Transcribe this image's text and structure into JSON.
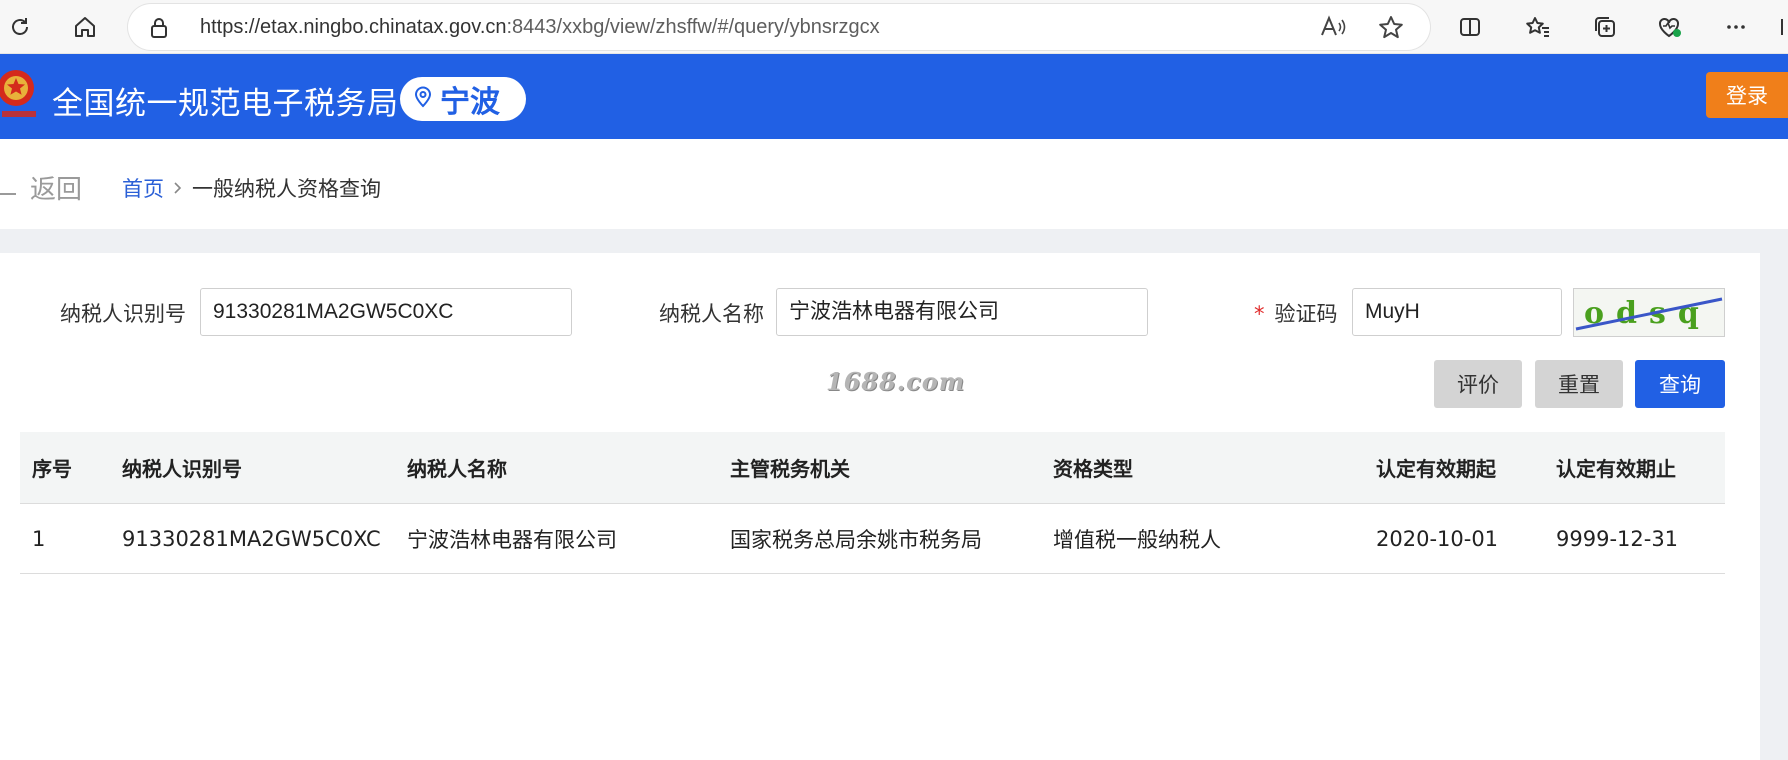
{
  "browser": {
    "url_main": "https://etax.ningbo.chinatax.gov.cn",
    "url_rest": ":8443/xxbg/view/zhsffw/#/query/ybnsrzgcx"
  },
  "header": {
    "title": "全国统一规范电子税务局",
    "city": "宁波",
    "login_label": "登录",
    "brand_color": "#2160e4"
  },
  "nav": {
    "back_label": "返回",
    "home_label": "首页",
    "current_label": "一般纳税人资格查询"
  },
  "form": {
    "taxpayer_id_label": "纳税人识别号",
    "taxpayer_id_value": "91330281MA2GW5C0XC",
    "taxpayer_name_label": "纳税人名称",
    "taxpayer_name_value": "宁波浩林电器有限公司",
    "captcha_label": "验证码",
    "captcha_required_mark": "*",
    "captcha_value": "MuyH",
    "captcha_image_text": "odsq",
    "watermark": "1688.com",
    "buttons": {
      "rate": "评价",
      "reset": "重置",
      "query": "查询"
    }
  },
  "table": {
    "headers": [
      "序号",
      "纳税人识别号",
      "纳税人名称",
      "主管税务机关",
      "资格类型",
      "认定有效期起",
      "认定有效期止"
    ],
    "rows": [
      [
        "1",
        "91330281MA2GW5C0XC",
        "宁波浩林电器有限公司",
        "国家税务总局余姚市税务局",
        "增值税一般纳税人",
        "2020-10-01",
        "9999-12-31"
      ]
    ]
  }
}
